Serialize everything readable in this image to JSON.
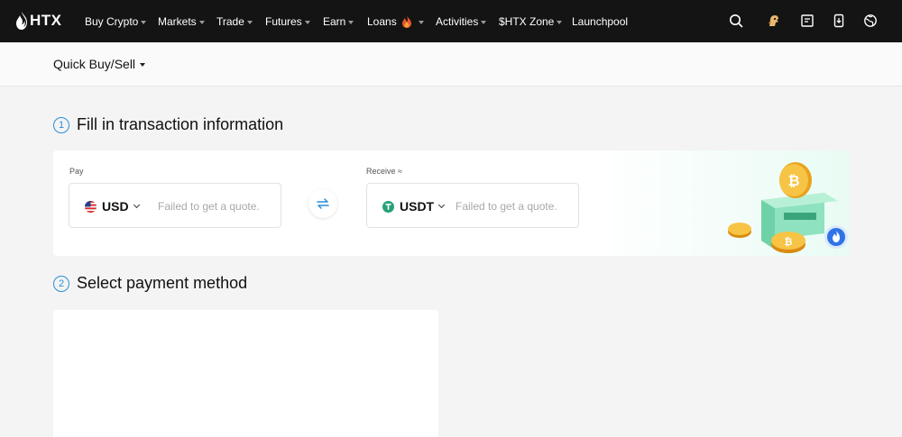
{
  "brand": {
    "logo_text": "HTX"
  },
  "nav": {
    "items": [
      {
        "label": "Buy Crypto",
        "dropdown": true
      },
      {
        "label": "Markets",
        "dropdown": true
      },
      {
        "label": "Trade",
        "dropdown": true
      },
      {
        "label": "Futures",
        "dropdown": true
      },
      {
        "label": "Earn",
        "dropdown": true
      },
      {
        "label": "Loans",
        "dropdown": true,
        "icon": "fire-icon"
      },
      {
        "label": "Activities",
        "dropdown": true
      },
      {
        "label": "$HTX Zone",
        "dropdown": true
      },
      {
        "label": "Launchpool",
        "dropdown": false
      }
    ],
    "right_icons": [
      "search-icon",
      "avatar-icon",
      "orders-icon",
      "download-icon",
      "language-icon"
    ]
  },
  "subheader": {
    "title": "Quick Buy/Sell"
  },
  "steps": [
    {
      "number": "1",
      "title": "Fill in transaction information"
    },
    {
      "number": "2",
      "title": "Select payment method"
    }
  ],
  "transaction": {
    "pay": {
      "label": "Pay",
      "currency": "USD",
      "flag": "us-flag-icon",
      "placeholder": "Failed to get a quote."
    },
    "receive": {
      "label": "Receive ≈",
      "currency": "USDT",
      "token": "tether-icon",
      "placeholder": "Failed to get a quote."
    },
    "swap_icon": "swap-arrows-icon"
  },
  "colors": {
    "nav_bg": "#141414",
    "accent_blue": "#2b8fd6",
    "tether_green": "#26a17b",
    "page_bg": "#f4f4f4"
  }
}
